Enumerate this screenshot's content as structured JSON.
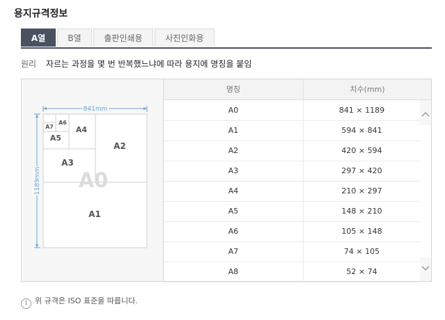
{
  "page": {
    "title": "용지규격정보"
  },
  "tabs": [
    {
      "label": "A열",
      "active": true
    },
    {
      "label": "B열",
      "active": false
    },
    {
      "label": "출판인쇄용",
      "active": false
    },
    {
      "label": "사진인화용",
      "active": false
    }
  ],
  "principle": {
    "label": "원리",
    "text": "자르는 과정을 몇 번 반복했느냐에 따라 용지에 명칭을 붙임"
  },
  "diagram": {
    "width_label": "841mm",
    "height_label": "1189mm",
    "labels": {
      "A0": "A0",
      "A1": "A1",
      "A2": "A2",
      "A3": "A3",
      "A4": "A4",
      "A5": "A5",
      "A6": "A6",
      "A7": "A7"
    }
  },
  "table": {
    "headers": [
      "명칭",
      "치수(mm)"
    ],
    "rows": [
      [
        "A0",
        "841 × 1189"
      ],
      [
        "A1",
        "594 × 841"
      ],
      [
        "A2",
        "420 × 594"
      ],
      [
        "A3",
        "297 × 420"
      ],
      [
        "A4",
        "210 × 297"
      ],
      [
        "A5",
        "148 × 210"
      ],
      [
        "A6",
        "105 × 148"
      ],
      [
        "A7",
        "74 × 105"
      ],
      [
        "A8",
        "52 × 74"
      ]
    ]
  },
  "footnote": {
    "icon": "info-icon",
    "text": "위 규격은 ISO 표준을 따릅니다."
  }
}
